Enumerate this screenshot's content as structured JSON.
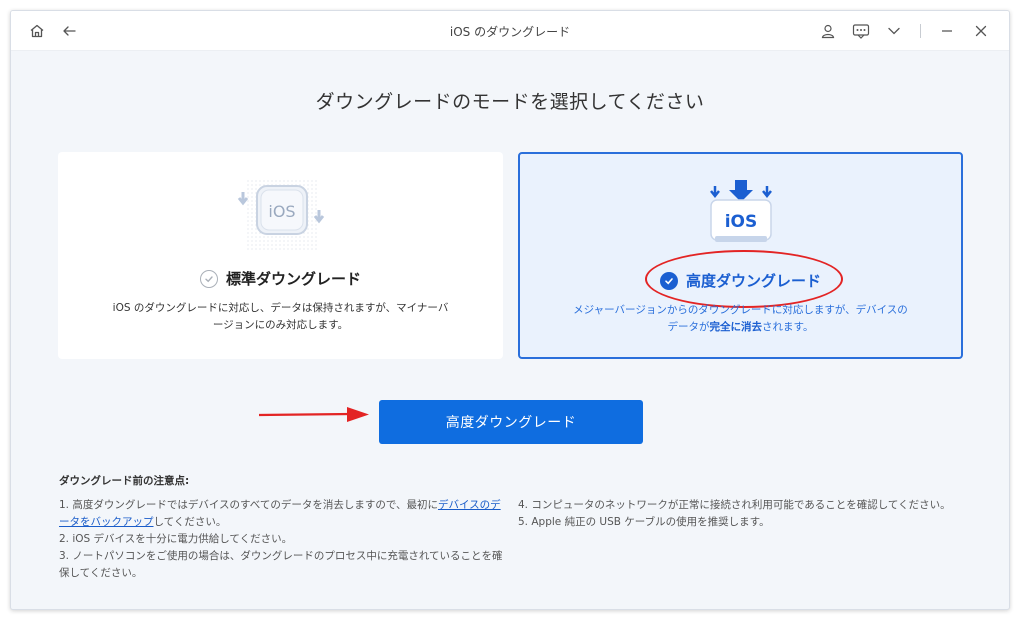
{
  "window": {
    "title": "iOS のダウングレード"
  },
  "heading": "ダウングレードのモードを選択してください",
  "cards": {
    "standard": {
      "icon_text": "iOS",
      "title": "標準ダウングレード",
      "desc": "iOS のダウングレードに対応し、データは保持されますが、マイナーバージョンにのみ対応します。",
      "selected": false
    },
    "advanced": {
      "icon_text": "iOS",
      "title": "高度ダウングレード",
      "desc_part1": "メジャーバージョンからのダウングレードに対応しますが、デバイスのデータが",
      "desc_bold": "完全に消去",
      "desc_part2": "されます。",
      "selected": true
    }
  },
  "primary_button": {
    "label": "高度ダウングレード"
  },
  "notes": {
    "title": "ダウングレード前の注意点:",
    "item1_pre": "1. 高度ダウングレードではデバイスのすべてのデータを消去しますので、最初に",
    "item1_link": "デバイスのデータをバックアップ",
    "item1_post": "してください。",
    "item2": "2. iOS デバイスを十分に電力供給してください。",
    "item3": "3. ノートパソコンをご使用の場合は、ダウングレードのプロセス中に充電されていることを確保してください。",
    "item4": "4. コンピュータのネットワークが正常に接続され利用可能であることを確認してください。",
    "item5": "5. Apple 純正の USB ケーブルの使用を推奨します。"
  },
  "colors": {
    "accent": "#0f6de0",
    "selected_border": "#2a6fdb",
    "annotation_red": "#e32424"
  },
  "icons": [
    "home-icon",
    "back-arrow-icon",
    "user-icon",
    "feedback-icon",
    "chevron-down-icon",
    "close-icon",
    "check-icon"
  ]
}
